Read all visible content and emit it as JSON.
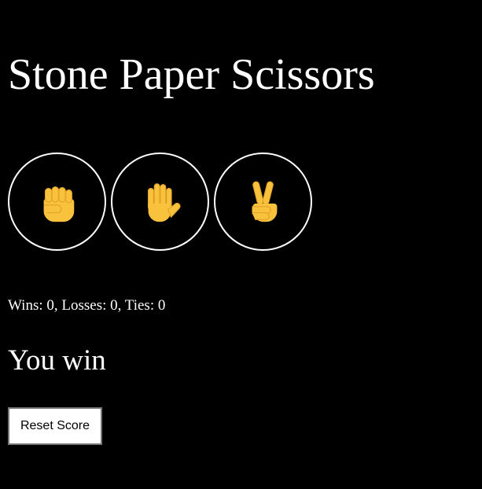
{
  "app": {
    "title": "Stone Paper Scissors"
  },
  "moves": [
    {
      "name": "stone",
      "icon": "raised-fist-icon",
      "emoji": "✊"
    },
    {
      "name": "paper",
      "icon": "raised-hand-icon",
      "emoji": "🖐"
    },
    {
      "name": "scissors",
      "icon": "victory-hand-icon",
      "emoji": "✌"
    }
  ],
  "score": {
    "text": "Wins: 0, Losses: 0, Ties: 0",
    "wins": 0,
    "losses": 0,
    "ties": 0
  },
  "result": {
    "text": "You win"
  },
  "controls": {
    "reset_label": "Reset Score"
  },
  "colors": {
    "background": "#000000",
    "text": "#ffffff",
    "icon_skin": "#F9C23C",
    "icon_shadow": "#E3A329"
  }
}
